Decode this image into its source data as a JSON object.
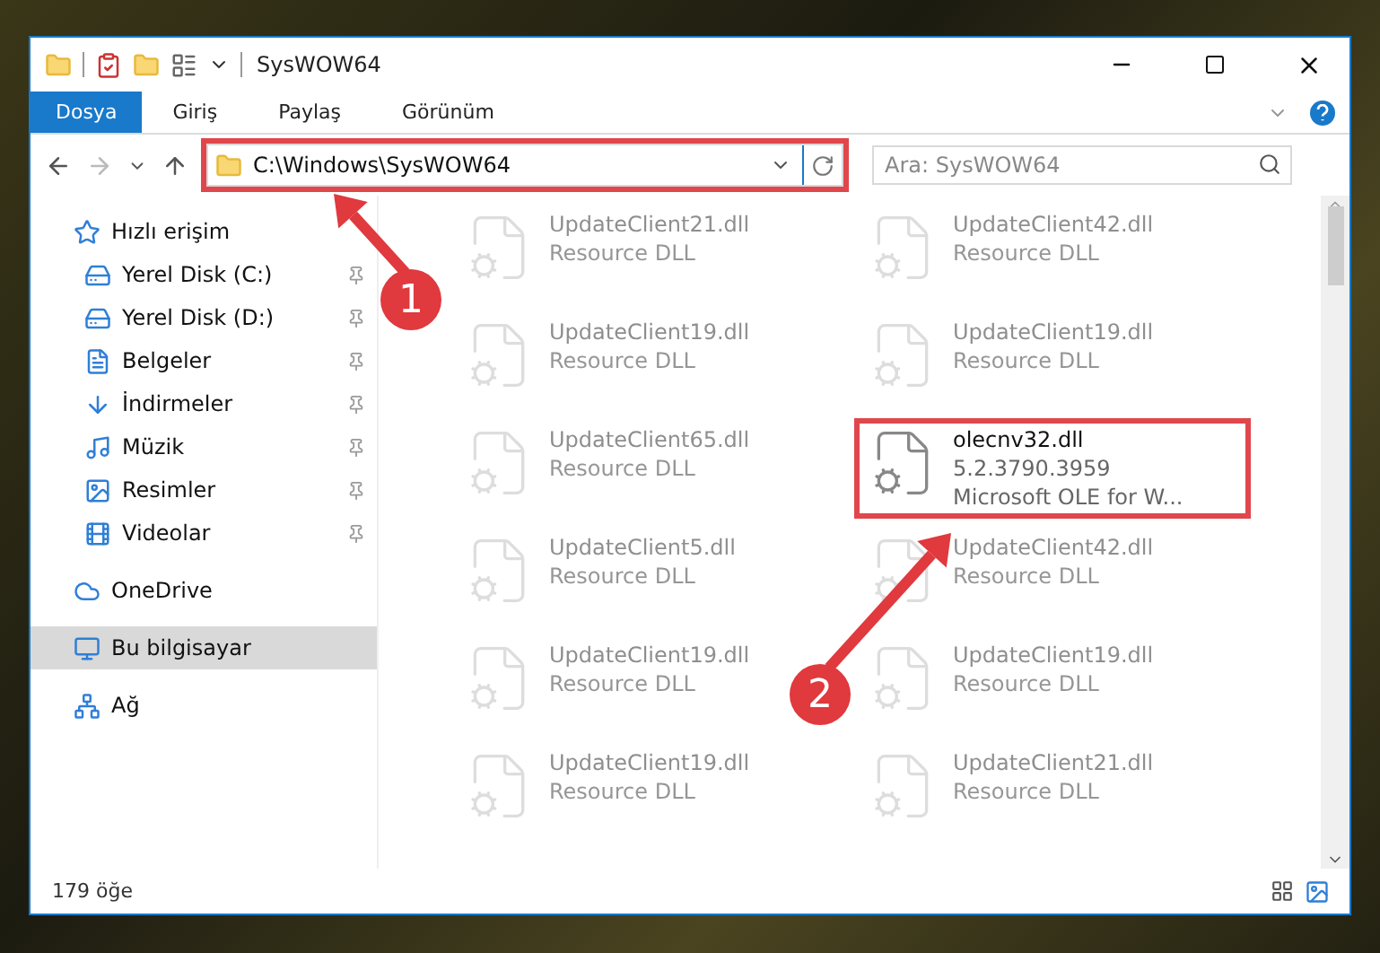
{
  "window": {
    "title": "SysWOW64"
  },
  "tabs": [
    {
      "label": "Dosya",
      "selected": true
    },
    {
      "label": "Giriş",
      "selected": false
    },
    {
      "label": "Paylaş",
      "selected": false
    },
    {
      "label": "Görünüm",
      "selected": false
    }
  ],
  "address": {
    "value": "C:\\Windows\\SysWOW64",
    "highlighted": true
  },
  "search": {
    "placeholder": "Ara: SysWOW64"
  },
  "sidebar": {
    "items": [
      {
        "label": "Hızlı erişim",
        "selected": false,
        "children": [
          {
            "label": "Yerel Disk (C:)",
            "pinned": true,
            "selected": false
          },
          {
            "label": "Yerel Disk (D:)",
            "pinned": true,
            "selected": false
          },
          {
            "label": "Belgeler",
            "pinned": true,
            "selected": false
          },
          {
            "label": "İndirmeler",
            "pinned": true,
            "selected": false
          },
          {
            "label": "Müzik",
            "pinned": true,
            "selected": false
          },
          {
            "label": "Resimler",
            "pinned": true,
            "selected": false
          },
          {
            "label": "Videolar",
            "pinned": true,
            "selected": false
          }
        ]
      },
      {
        "label": "OneDrive",
        "selected": false
      },
      {
        "label": "Bu bilgisayar",
        "selected": true
      },
      {
        "label": "Ağ",
        "selected": false
      }
    ]
  },
  "files": [
    {
      "name": "UpdateClient21.dll",
      "lines": [
        "Resource DLL"
      ],
      "faded": true,
      "highlighted": false
    },
    {
      "name": "UpdateClient42.dll",
      "lines": [
        "Resource DLL"
      ],
      "faded": true,
      "highlighted": false
    },
    {
      "name": "UpdateClient19.dll",
      "lines": [
        "Resource DLL"
      ],
      "faded": true,
      "highlighted": false
    },
    {
      "name": "UpdateClient19.dll",
      "lines": [
        "Resource DLL"
      ],
      "faded": true,
      "highlighted": false
    },
    {
      "name": "UpdateClient65.dll",
      "lines": [
        "Resource DLL"
      ],
      "faded": true,
      "highlighted": false
    },
    {
      "name": "olecnv32.dll",
      "lines": [
        "5.2.3790.3959",
        "Microsoft OLE for W..."
      ],
      "faded": false,
      "highlighted": true
    },
    {
      "name": "UpdateClient5.dll",
      "lines": [
        "Resource DLL"
      ],
      "faded": true,
      "highlighted": false
    },
    {
      "name": "UpdateClient42.dll",
      "lines": [
        "Resource DLL"
      ],
      "faded": true,
      "highlighted": false
    },
    {
      "name": "UpdateClient19.dll",
      "lines": [
        "Resource DLL"
      ],
      "faded": true,
      "highlighted": false
    },
    {
      "name": "UpdateClient19.dll",
      "lines": [
        "Resource DLL"
      ],
      "faded": true,
      "highlighted": false
    },
    {
      "name": "UpdateClient19.dll",
      "lines": [
        "Resource DLL"
      ],
      "faded": true,
      "highlighted": false
    },
    {
      "name": "UpdateClient21.dll",
      "lines": [
        "Resource DLL"
      ],
      "faded": true,
      "highlighted": false
    }
  ],
  "status_bar": {
    "count": "179 öğe"
  },
  "annotations": [
    {
      "label": "1"
    },
    {
      "label": "2"
    }
  ]
}
